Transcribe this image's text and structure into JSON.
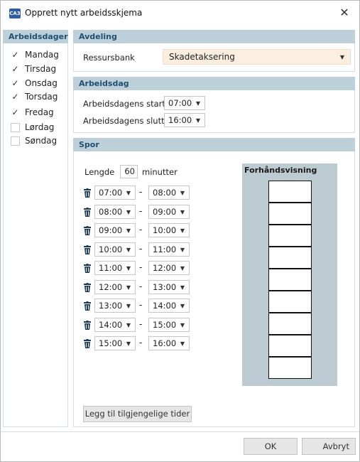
{
  "window": {
    "title": "Opprett nytt arbeidsskjema",
    "app_icon_text": "CA3",
    "close_glyph": "✕"
  },
  "days": {
    "header": "Arbeidsdager",
    "items": [
      {
        "label": "Mandag",
        "checked": true
      },
      {
        "label": "Tirsdag",
        "checked": true
      },
      {
        "label": "Onsdag",
        "checked": true
      },
      {
        "label": "Torsdag",
        "checked": true
      },
      {
        "label": "Fredag",
        "checked": true
      },
      {
        "label": "Lørdag",
        "checked": false
      },
      {
        "label": "Søndag",
        "checked": false
      }
    ]
  },
  "avdeling": {
    "header": "Avdeling",
    "resource_label": "Ressursbank",
    "resource_value": "Skadetaksering"
  },
  "arbeidsdag": {
    "header": "Arbeidsdag",
    "start_label": "Arbeidsdagens start",
    "start_value": "07:00",
    "end_label": "Arbeidsdagens slutt",
    "end_value": "16:00"
  },
  "spor": {
    "header": "Spor",
    "length_label": "Lengde",
    "length_value": "60",
    "length_unit": "minutter",
    "separator": "-",
    "slots": [
      {
        "from": "07:00",
        "to": "08:00"
      },
      {
        "from": "08:00",
        "to": "09:00"
      },
      {
        "from": "09:00",
        "to": "10:00"
      },
      {
        "from": "10:00",
        "to": "11:00"
      },
      {
        "from": "11:00",
        "to": "12:00"
      },
      {
        "from": "12:00",
        "to": "13:00"
      },
      {
        "from": "13:00",
        "to": "14:00"
      },
      {
        "from": "14:00",
        "to": "15:00"
      },
      {
        "from": "15:00",
        "to": "16:00"
      }
    ],
    "preview_title": "Forhåndsvisning",
    "add_button": "Legg til tilgjengelige tider"
  },
  "footer": {
    "ok_label": "OK",
    "cancel_label": "Avbryt"
  },
  "icons": {
    "dropdown": "chevron-down-icon",
    "trash": "trash-icon",
    "check": "check-icon"
  },
  "colors": {
    "section_header_bg": "#bdd0da",
    "section_header_text": "#1f4f73",
    "highlight_dropdown_bg": "#fcefe0",
    "preview_bg": "#bccbd2"
  }
}
